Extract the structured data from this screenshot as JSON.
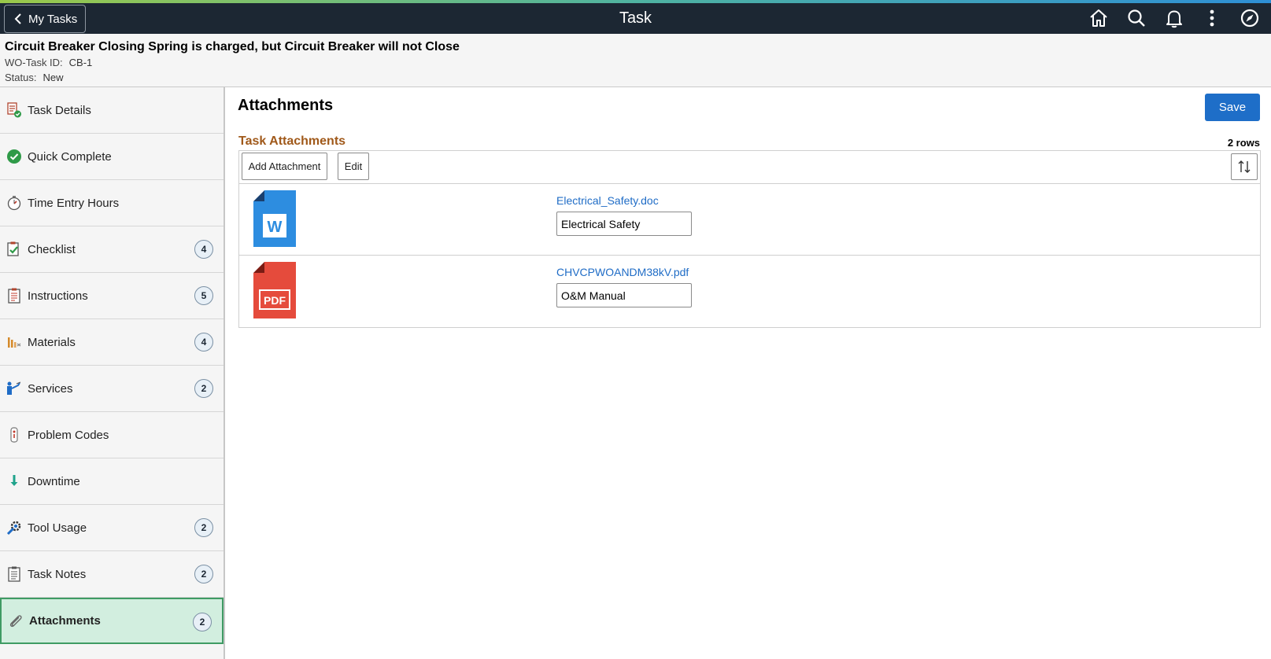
{
  "topbar": {
    "back_label": "My Tasks",
    "title": "Task",
    "icons": [
      "home-icon",
      "search-icon",
      "bell-icon",
      "more-vert-icon",
      "navbar-compass-icon"
    ]
  },
  "header": {
    "title": "Circuit Breaker Closing Spring is charged, but Circuit Breaker will not Close",
    "task_id_label": "WO-Task ID:",
    "task_id_value": "CB-1",
    "status_label": "Status:",
    "status_value": "New"
  },
  "sidebar": {
    "items": [
      {
        "label": "Task Details",
        "icon": "task-details-icon",
        "badge": ""
      },
      {
        "label": "Quick Complete",
        "icon": "check-circle-icon",
        "badge": ""
      },
      {
        "label": "Time Entry Hours",
        "icon": "stopwatch-icon",
        "badge": ""
      },
      {
        "label": "Checklist",
        "icon": "checklist-icon",
        "badge": "4"
      },
      {
        "label": "Instructions",
        "icon": "instructions-icon",
        "badge": "5"
      },
      {
        "label": "Materials",
        "icon": "materials-icon",
        "badge": "4"
      },
      {
        "label": "Services",
        "icon": "services-icon",
        "badge": "2"
      },
      {
        "label": "Problem Codes",
        "icon": "problem-codes-icon",
        "badge": ""
      },
      {
        "label": "Downtime",
        "icon": "down-arrow-icon",
        "badge": ""
      },
      {
        "label": "Tool Usage",
        "icon": "tool-icon",
        "badge": "2"
      },
      {
        "label": "Task Notes",
        "icon": "notes-icon",
        "badge": "2"
      },
      {
        "label": "Attachments",
        "icon": "paperclip-icon",
        "badge": "2",
        "active": true
      }
    ]
  },
  "main": {
    "title": "Attachments",
    "save_label": "Save",
    "grid_title": "Task Attachments",
    "row_count": "2 rows",
    "add_label": "Add Attachment",
    "edit_label": "Edit",
    "rows": [
      {
        "file_name": "Electrical_Safety.doc",
        "description": "Electrical Safety",
        "type": "word",
        "type_letter": "W",
        "color": "#2d8de0"
      },
      {
        "file_name": "CHVCPWOANDM38kV.pdf",
        "description": "O&M Manual",
        "type": "pdf",
        "type_letter": "PDF",
        "color": "#e54b3c"
      }
    ]
  },
  "colors": {
    "topbar_bg": "#1c2733",
    "accent_green": "#3f9b64",
    "save_blue": "#1e6ec8",
    "grid_title_orange": "#a0591a",
    "link_blue": "#1f6cc6"
  }
}
